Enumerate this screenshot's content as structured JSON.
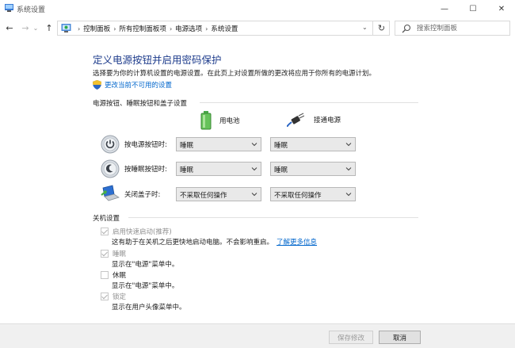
{
  "window": {
    "title": "系统设置",
    "buttons": {
      "minimize": "—",
      "maximize": "☐",
      "close": "✕"
    }
  },
  "nav": {
    "back": "←",
    "forward": "→",
    "history": "⌄",
    "up": "↑",
    "separator": "›",
    "breadcrumbs": [
      "控制面板",
      "所有控制面板项",
      "电源选项",
      "系统设置"
    ],
    "dropdown": "⌄",
    "refresh": "↻",
    "search_placeholder": "搜索控制面板"
  },
  "header": {
    "title": "定义电源按钮并启用密码保护",
    "description": "选择要为你的计算机设置的电源设置。在此页上对设置所做的更改将应用于你所有的电源计划。",
    "change_link": "更改当前不可用的设置"
  },
  "power_section": {
    "heading": "电源按钮、睡眠按钮和盖子设置",
    "columns": {
      "battery": "用电池",
      "plugged": "接通电源"
    },
    "rows": [
      {
        "label": "按电源按钮时:",
        "battery_value": "睡眠",
        "plugged_value": "睡眠",
        "icon": "power-button-icon"
      },
      {
        "label": "按睡眠按钮时:",
        "battery_value": "睡眠",
        "plugged_value": "睡眠",
        "icon": "sleep-button-icon"
      },
      {
        "label": "关闭盖子时:",
        "battery_value": "不采取任何操作",
        "plugged_value": "不采取任何操作",
        "icon": "laptop-lid-icon"
      }
    ]
  },
  "shutdown_section": {
    "heading": "关机设置",
    "items": [
      {
        "label": "启用快速启动(推荐)",
        "checked": true,
        "enabled": false,
        "description": "这有助于在关机之后更快地启动电脑。不会影响重启。",
        "link": "了解更多信息"
      },
      {
        "label": "睡眠",
        "checked": true,
        "enabled": false,
        "description": "显示在\"电源\"菜单中。"
      },
      {
        "label": "休眠",
        "checked": false,
        "enabled": true,
        "description": "显示在\"电源\"菜单中。"
      },
      {
        "label": "锁定",
        "checked": true,
        "enabled": false,
        "description": "显示在用户头像菜单中。"
      }
    ]
  },
  "footer": {
    "save": "保存修改",
    "cancel": "取消"
  },
  "colors": {
    "title": "#1e3c8c",
    "link": "#0066cc",
    "footer_bg": "#f0f0f0"
  }
}
